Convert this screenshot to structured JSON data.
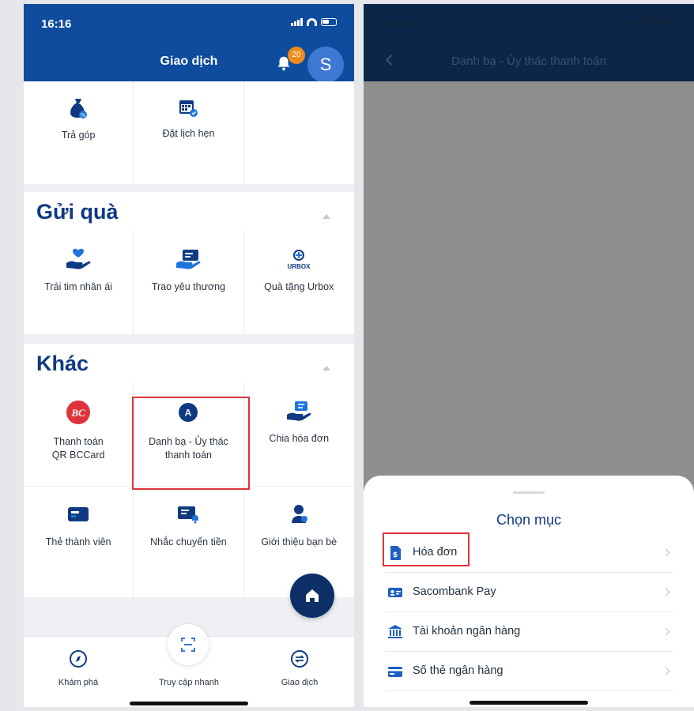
{
  "left_screen": {
    "status_time": "16:16",
    "header_title": "Giao dịch",
    "notification_count": "20",
    "avatar_letter": "S",
    "top_row": [
      {
        "label": "Trả góp",
        "icon": "money-bag-icon"
      },
      {
        "label": "Đặt lịch hẹn",
        "icon": "calendar-icon"
      },
      {
        "label": "",
        "icon": ""
      }
    ],
    "gift_section": {
      "title": "Gửi quà",
      "items": [
        {
          "label": "Trái tim nhân ái",
          "icon": "heart-hand-icon"
        },
        {
          "label": "Trao yêu thương",
          "icon": "card-hand-icon"
        },
        {
          "label": "Quà tặng Urbox",
          "icon": "urbox-icon",
          "logo_text": "URBOX"
        }
      ]
    },
    "other_section": {
      "title": "Khác",
      "row1": [
        {
          "label": "Thanh toán\nQR BCCard",
          "icon": "bccard-icon",
          "logo_text": "BC"
        },
        {
          "label": "Danh bạ - Ủy thác\nthanh toán",
          "icon": "contact-a-icon",
          "logo_text": "A"
        },
        {
          "label": "Chia hóa đơn",
          "icon": "split-bill-icon"
        }
      ],
      "row2": [
        {
          "label": "Thẻ thành viên",
          "icon": "member-card-icon"
        },
        {
          "label": "Nhắc chuyển tiền",
          "icon": "transfer-reminder-icon"
        },
        {
          "label": "Giới thiệu bạn bè",
          "icon": "refer-friend-icon"
        }
      ]
    },
    "tabbar": [
      {
        "label": "Khám phá",
        "icon": "compass-icon"
      },
      {
        "label": "Truy cập nhanh",
        "icon": "scan-icon"
      },
      {
        "label": "Giao dịch",
        "icon": "exchange-icon"
      }
    ]
  },
  "right_screen": {
    "status_time": "16:16",
    "header_title": "Danh bạ - Ủy thác thanh toán",
    "sheet_title": "Chọn mục",
    "options": [
      {
        "label": "Hóa đơn",
        "icon": "invoice-icon"
      },
      {
        "label": "Sacombank Pay",
        "icon": "id-card-icon"
      },
      {
        "label": "Tài khoản ngân hàng",
        "icon": "bank-icon"
      },
      {
        "label": "Số thẻ ngân hàng",
        "icon": "credit-card-icon"
      }
    ]
  },
  "colors": {
    "primary_blue": "#0f4c9e",
    "dark_navy": "#0d2f67",
    "heading_blue": "#0f3a82",
    "highlight_red": "#e0323b",
    "badge_orange": "#f08b1d",
    "bccard_red": "#e0323b"
  }
}
